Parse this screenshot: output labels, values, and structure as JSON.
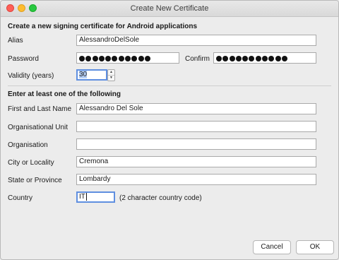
{
  "window": {
    "title": "Create New Certificate"
  },
  "section1": {
    "heading": "Create a new signing certificate for Android applications"
  },
  "alias": {
    "label": "Alias",
    "value": "AlessandroDelSole"
  },
  "password": {
    "label": "Password",
    "masked_length": 11
  },
  "confirm": {
    "label": "Confirm",
    "masked_length": 11
  },
  "validity": {
    "label": "Validity (years)",
    "value": "30"
  },
  "section2": {
    "heading": "Enter at least one of the following"
  },
  "fields": {
    "name": {
      "label": "First and Last Name",
      "value": "Alessandro Del Sole"
    },
    "unit": {
      "label": "Organisational Unit",
      "value": ""
    },
    "org": {
      "label": "Organisation",
      "value": ""
    },
    "city": {
      "label": "City or Locality",
      "value": "Cremona"
    },
    "state": {
      "label": "State or Province",
      "value": "Lombardy"
    },
    "country": {
      "label": "Country",
      "value": "IT",
      "hint": "(2 character country code)"
    }
  },
  "buttons": {
    "cancel": "Cancel",
    "ok": "OK"
  },
  "colors": {
    "focus_ring": "#5f8fe0",
    "close": "#fe5f57",
    "minimize": "#febc2e",
    "zoom": "#28c840"
  }
}
